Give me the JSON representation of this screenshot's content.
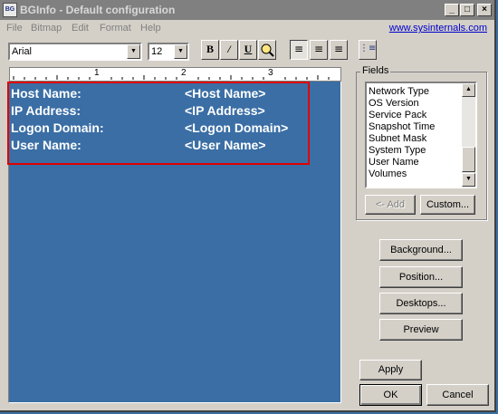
{
  "window": {
    "title": "BGInfo - Default configuration",
    "app_icon": "BG"
  },
  "titlebar_buttons": {
    "minimize": "_",
    "maximize": "□",
    "close": "×"
  },
  "menu": [
    "File",
    "Bitmap",
    "Edit",
    "Format",
    "Help"
  ],
  "link": "www.sysinternals.com",
  "toolbar": {
    "font_name": "Arial",
    "font_size": "12",
    "bold": "B",
    "italic": "/",
    "underline": "U",
    "align_left": "≡",
    "align_center": "≡",
    "align_right": "≡",
    "bullets": "⋮≡"
  },
  "ruler_numbers": [
    "1",
    "2",
    "3"
  ],
  "editor_lines": [
    {
      "label": "Host Name:",
      "value": "<Host Name>"
    },
    {
      "label": "IP Address:",
      "value": "<IP Address>"
    },
    {
      "label": "Logon Domain:",
      "value": "<Logon Domain>"
    },
    {
      "label": "User Name:",
      "value": "<User Name>"
    }
  ],
  "fields": {
    "label": "Fields",
    "items": [
      "Network Type",
      "OS Version",
      "Service Pack",
      "Snapshot Time",
      "Subnet Mask",
      "System Type",
      "User Name",
      "Volumes"
    ],
    "add_button": "<- Add",
    "custom_button": "Custom..."
  },
  "buttons": {
    "background": "Background...",
    "position": "Position...",
    "desktops": "Desktops...",
    "preview": "Preview",
    "apply": "Apply",
    "ok": "OK",
    "cancel": "Cancel"
  },
  "colors": {
    "desktop_blue": "#3a6ea5",
    "highlight_red": "#e00000",
    "link_blue": "#0000cc"
  }
}
